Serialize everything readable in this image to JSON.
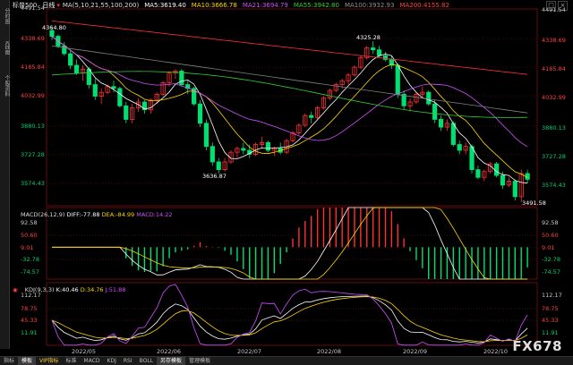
{
  "side_tabs": [
    "分时图",
    "K线图",
    "个股资料"
  ],
  "window_controls": [
    "□",
    "×"
  ],
  "header": {
    "symbol": "标普500",
    "period": "日线",
    "ma_label": "MA(5,10,21,55,100,200)",
    "ma5": "MA5:3619.40",
    "ma10": "MA10:3666.78",
    "ma21": "MA21:3694.79",
    "ma55": "MA55:3942.80",
    "ma100": "MA100:3932.93",
    "ma200": "MA200:4155.82"
  },
  "price_axis": [
    "4491.54",
    "4338.69",
    "4185.84",
    "4032.99",
    "3880.13",
    "3727.28",
    "3574.43"
  ],
  "price_annotations": {
    "high1": "4364.80",
    "high2": "4325.28",
    "low1": "3636.87",
    "low2": "3491.58"
  },
  "macd": {
    "label": "MACD(26,12,9)",
    "diff": "DIFF:-77.88",
    "dea": "DEA:-84.99",
    "macd": "MACD:14.22",
    "axis": [
      "92.58",
      "50.60",
      "9.01",
      "-32.78",
      "-74.57"
    ]
  },
  "kdj": {
    "label": "KDJ(9,3,3)",
    "k": "K:40.46",
    "d": "D:34.76",
    "j": "J:51.88",
    "axis": [
      "112.17",
      "78.75",
      "45.33",
      "11.91"
    ]
  },
  "x_axis": [
    "2022/05",
    "2022/06",
    "2022/07",
    "2022/08",
    "2022/09",
    "2022/10"
  ],
  "bottom_tabs": [
    "指标",
    "模板",
    "VIP指标",
    "标准",
    "MACD",
    "KDJ",
    "RSI",
    "BOLL",
    "另存模板",
    "管理模板"
  ],
  "watermark": "FX678",
  "colors": {
    "up": "#ff3030",
    "down": "#00e070",
    "ma5": "#ffffff",
    "ma10": "#ffd700",
    "ma21": "#d050ff",
    "ma55": "#30d030",
    "ma100": "#808080",
    "ma200": "#ff3030"
  },
  "chart_data": {
    "type": "candlestick",
    "ylim": [
      3491.58,
      4491.54
    ],
    "candles": [
      [
        4380,
        4400,
        4330,
        4350
      ],
      [
        4350,
        4360,
        4290,
        4300
      ],
      [
        4300,
        4320,
        4250,
        4260
      ],
      [
        4260,
        4280,
        4180,
        4200
      ],
      [
        4200,
        4230,
        4150,
        4160
      ],
      [
        4160,
        4200,
        4120,
        4180
      ],
      [
        4180,
        4190,
        4080,
        4100
      ],
      [
        4100,
        4130,
        4020,
        4040
      ],
      [
        4040,
        4080,
        4000,
        4060
      ],
      [
        4060,
        4100,
        4050,
        4090
      ],
      [
        4090,
        4120,
        4060,
        4080
      ],
      [
        4080,
        4090,
        3980,
        3990
      ],
      [
        3990,
        4010,
        3900,
        3920
      ],
      [
        3920,
        4000,
        3900,
        3980
      ],
      [
        3980,
        4030,
        3960,
        4010
      ],
      [
        4010,
        4020,
        3950,
        3970
      ],
      [
        3970,
        4030,
        3950,
        4020
      ],
      [
        4020,
        4060,
        4000,
        4050
      ],
      [
        4050,
        4120,
        4040,
        4110
      ],
      [
        4110,
        4170,
        4090,
        4160
      ],
      [
        4160,
        4180,
        4130,
        4170
      ],
      [
        4170,
        4180,
        4090,
        4100
      ],
      [
        4100,
        4120,
        4050,
        4080
      ],
      [
        4080,
        4090,
        3990,
        4000
      ],
      [
        4000,
        4020,
        3880,
        3900
      ],
      [
        3900,
        3920,
        3760,
        3780
      ],
      [
        3780,
        3800,
        3680,
        3700
      ],
      [
        3700,
        3720,
        3640,
        3660
      ],
      [
        3660,
        3720,
        3650,
        3700
      ],
      [
        3700,
        3760,
        3690,
        3750
      ],
      [
        3750,
        3780,
        3720,
        3770
      ],
      [
        3770,
        3800,
        3740,
        3760
      ],
      [
        3760,
        3790,
        3720,
        3740
      ],
      [
        3740,
        3800,
        3730,
        3790
      ],
      [
        3790,
        3830,
        3770,
        3800
      ],
      [
        3800,
        3810,
        3750,
        3760
      ],
      [
        3760,
        3780,
        3730,
        3770
      ],
      [
        3770,
        3800,
        3740,
        3750
      ],
      [
        3750,
        3820,
        3740,
        3810
      ],
      [
        3810,
        3860,
        3800,
        3850
      ],
      [
        3850,
        3900,
        3840,
        3890
      ],
      [
        3890,
        3950,
        3880,
        3940
      ],
      [
        3940,
        3960,
        3900,
        3930
      ],
      [
        3930,
        3990,
        3920,
        3980
      ],
      [
        3980,
        4040,
        3970,
        4030
      ],
      [
        4030,
        4080,
        4020,
        4070
      ],
      [
        4070,
        4110,
        4060,
        4100
      ],
      [
        4100,
        4130,
        4080,
        4120
      ],
      [
        4120,
        4160,
        4100,
        4150
      ],
      [
        4150,
        4200,
        4140,
        4190
      ],
      [
        4190,
        4250,
        4180,
        4240
      ],
      [
        4240,
        4300,
        4230,
        4290
      ],
      [
        4290,
        4325,
        4260,
        4280
      ],
      [
        4280,
        4300,
        4240,
        4250
      ],
      [
        4250,
        4270,
        4220,
        4230
      ],
      [
        4230,
        4250,
        4180,
        4200
      ],
      [
        4200,
        4210,
        4030,
        4050
      ],
      [
        4050,
        4070,
        3970,
        3990
      ],
      [
        3990,
        4030,
        3960,
        4010
      ],
      [
        4010,
        4060,
        4000,
        4050
      ],
      [
        4050,
        4090,
        4030,
        4060
      ],
      [
        4060,
        4070,
        3990,
        4000
      ],
      [
        4000,
        4020,
        3900,
        3920
      ],
      [
        3920,
        3940,
        3860,
        3880
      ],
      [
        3880,
        3920,
        3860,
        3900
      ],
      [
        3900,
        3910,
        3780,
        3790
      ],
      [
        3790,
        3810,
        3740,
        3760
      ],
      [
        3760,
        3800,
        3740,
        3780
      ],
      [
        3780,
        3790,
        3640,
        3660
      ],
      [
        3660,
        3680,
        3610,
        3620
      ],
      [
        3620,
        3660,
        3600,
        3650
      ],
      [
        3650,
        3700,
        3640,
        3690
      ],
      [
        3690,
        3700,
        3620,
        3630
      ],
      [
        3630,
        3650,
        3560,
        3580
      ],
      [
        3580,
        3620,
        3570,
        3600
      ],
      [
        3600,
        3610,
        3500,
        3520
      ],
      [
        3520,
        3660,
        3491,
        3640
      ],
      [
        3640,
        3660,
        3590,
        3610
      ]
    ],
    "macd_hist_range": [
      -74.57,
      92.58
    ],
    "kdj_range": [
      11.91,
      112.17
    ]
  }
}
